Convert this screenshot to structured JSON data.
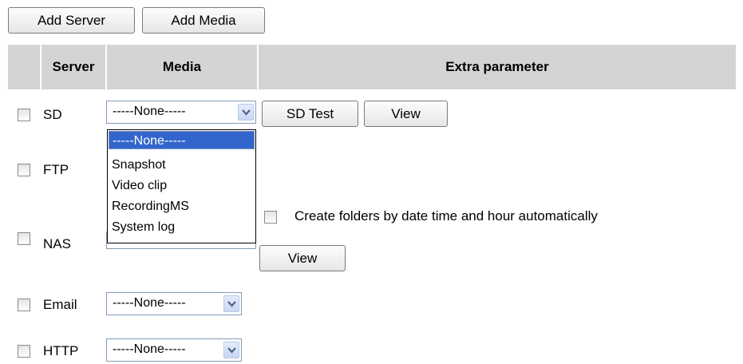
{
  "toolbar": {
    "add_server": "Add Server",
    "add_media": "Add Media"
  },
  "table": {
    "headers": {
      "server": "Server",
      "media": "Media",
      "extra": "Extra parameter"
    }
  },
  "rows": {
    "sd": {
      "label": "SD",
      "media_value": "-----None-----",
      "test_button": "SD Test",
      "view_button": "View"
    },
    "ftp": {
      "label": "FTP"
    },
    "nas": {
      "label": "NAS",
      "create_folders_label": "Create folders by date time and hour automatically",
      "view_button": "View"
    },
    "email": {
      "label": "Email",
      "media_value": "-----None-----"
    },
    "http": {
      "label": "HTTP",
      "media_value": "-----None-----"
    }
  },
  "dropdown": {
    "options": [
      "-----None-----",
      "Snapshot",
      "Video clip",
      "RecordingMS",
      "System log"
    ],
    "selected": "-----None-----"
  },
  "icons": {
    "dropdown_arrow": "chevron-down-icon"
  }
}
